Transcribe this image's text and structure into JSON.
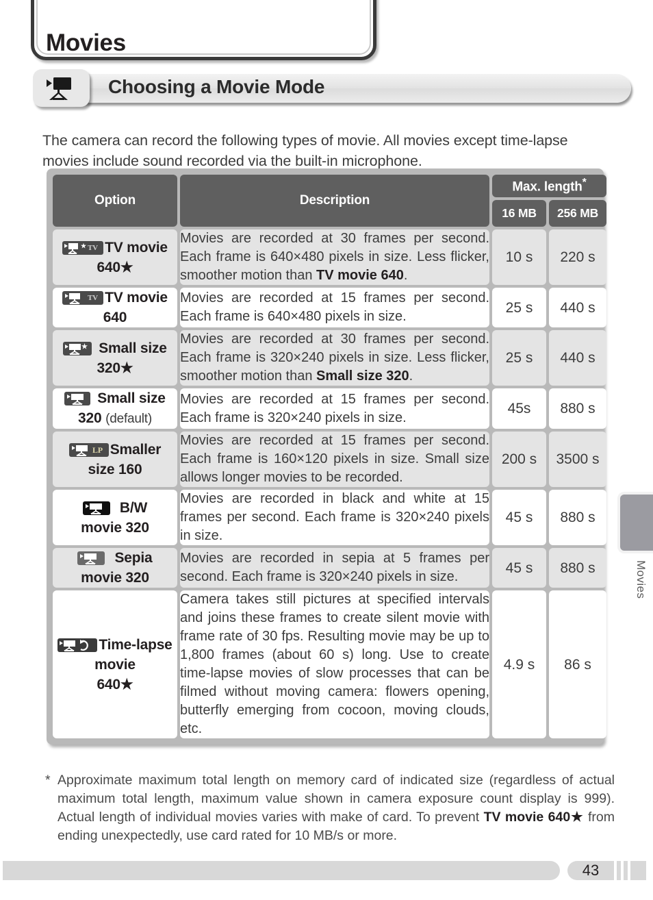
{
  "chapter": {
    "title": "Movies"
  },
  "section": {
    "title": "Choosing a Movie Mode",
    "icon": "movie-camera-icon"
  },
  "intro": "The camera can record the following types of movie.  All movies except time-lapse movies include sound recorded via the built-in microphone.",
  "table": {
    "headers": {
      "option": "Option",
      "description": "Description",
      "max_length": "Max. length",
      "max_length_footnote_mark": "*",
      "size_16": "16 MB",
      "size_256": "256 MB"
    },
    "rows": [
      {
        "icon": "movie-camera-tv-star-icon",
        "option_line1": "TV movie",
        "option_line2": "640★",
        "option_note": "",
        "description_pre": "Movies are recorded at 30 frames per second. Each frame is 640×480 pixels in size.  Less flicker, smoother motion than ",
        "description_bold": "TV movie 640",
        "description_post": ".",
        "len_16mb": "10 s",
        "len_256mb": "220 s",
        "shaded": true
      },
      {
        "icon": "movie-camera-tv-icon",
        "option_line1": "TV movie",
        "option_line2": "640",
        "option_note": "",
        "description_pre": "Movies are recorded at 15 frames per second. Each frame is 640×480 pixels in size.",
        "description_bold": "",
        "description_post": "",
        "len_16mb": "25 s",
        "len_256mb": "440 s",
        "shaded": false
      },
      {
        "icon": "movie-camera-star-icon",
        "option_line1": "Small size",
        "option_line2": "320★",
        "option_note": "",
        "description_pre": "Movies are recorded at 30 frames per second. Each frame is 320×240 pixels in size.  Less flicker, smoother motion than ",
        "description_bold": "Small size 320",
        "description_post": ".",
        "len_16mb": "25 s",
        "len_256mb": "440 s",
        "shaded": true
      },
      {
        "icon": "movie-camera-icon",
        "option_line1": "Small size",
        "option_line2": "320",
        "option_note": "(default)",
        "description_pre": "Movies are recorded at 15 frames per second. Each frame is 320×240 pixels in size.",
        "description_bold": "",
        "description_post": "",
        "len_16mb": "45s",
        "len_256mb": "880 s",
        "shaded": false
      },
      {
        "icon": "movie-camera-lp-icon",
        "option_line1": "Smaller",
        "option_line2": "size 160",
        "option_note": "",
        "description_pre": "Movies are recorded at 15 frames per second. Each frame is 160×120 pixels in size.  Small size allows longer movies to be recorded.",
        "description_bold": "",
        "description_post": "",
        "len_16mb": "200 s",
        "len_256mb": "3500 s",
        "shaded": true
      },
      {
        "icon": "movie-camera-bw-icon",
        "option_line1": "B/W",
        "option_line2": "movie 320",
        "option_note": "",
        "description_pre": "Movies are recorded in black and white at 15 frames per second.  Each frame is 320×240 pixels in size.",
        "description_bold": "",
        "description_post": "",
        "len_16mb": "45 s",
        "len_256mb": "880 s",
        "shaded": false
      },
      {
        "icon": "movie-camera-sepia-icon",
        "option_line1": "Sepia",
        "option_line2": "movie 320",
        "option_note": "",
        "description_pre": "Movies are recorded in sepia at 5 frames per second.  Each frame is 320×240 pixels in size.",
        "description_bold": "",
        "description_post": "",
        "len_16mb": "45 s",
        "len_256mb": "880 s",
        "shaded": true
      },
      {
        "icon": "movie-camera-timelapse-icon",
        "option_line1": "Time-lapse",
        "option_line2": "movie",
        "option_line3": "640★",
        "option_note": "",
        "description_pre": "Camera takes still pictures at specified intervals and joins these frames to create silent movie with frame rate of 30 fps.  Resulting movie may be up to 1,800 frames (about 60 s) long.  Use to create time-lapse movies of slow processes that can be filmed without moving camera: flowers opening, butterfly emerging from cocoon, moving clouds, etc.",
        "description_bold": "",
        "description_post": "",
        "len_16mb": "4.9 s",
        "len_256mb": "86 s",
        "shaded": false
      }
    ]
  },
  "footnote": {
    "mark": "*",
    "text_pre": "Approximate maximum total length on memory card of indicated size (regardless of actual maximum total length, maximum value shown in camera exposure count display is 999).  Actual length of individual movies varies with make of card.  To prevent ",
    "text_bold": "TV movie 640★",
    "text_post": " from ending unexpectedly, use card rated for 10 MB/s or more."
  },
  "side_tab": {
    "label": "Movies"
  },
  "footer": {
    "page_number": "43"
  },
  "colors": {
    "header_gray": "#5f5f5f",
    "row_shade": "#e4e4e4",
    "table_border": "#b9b9b9",
    "side_tab": "#9b9ba1",
    "footer_bar": "#d8d8d8"
  }
}
